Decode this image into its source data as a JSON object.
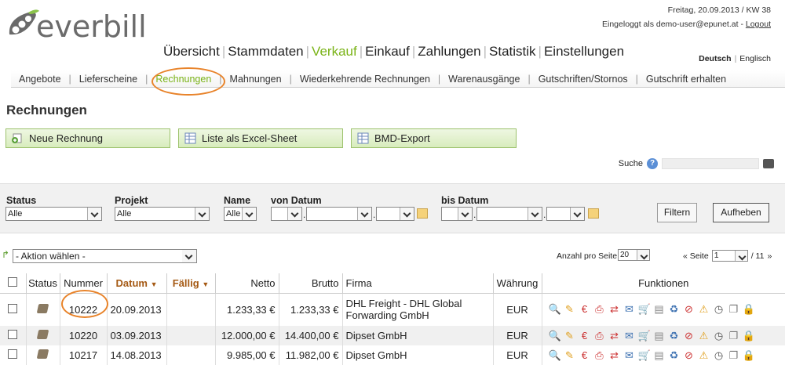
{
  "app": {
    "name": "everbill",
    "date_line": "Freitag, 20.09.2013 / KW 38",
    "login_prefix": "Eingeloggt als demo-user@epunet.at",
    "logout": "Logout",
    "lang_active": "Deutsch",
    "lang_other": "Englisch",
    "accent_color": "#7ab317",
    "highlight_color": "#e8832a"
  },
  "mainnav": [
    "Übersicht",
    "Stammdaten",
    "Verkauf",
    "Einkauf",
    "Zahlungen",
    "Statistik",
    "Einstellungen"
  ],
  "mainnav_active": "Verkauf",
  "subnav": [
    "Angebote",
    "Lieferscheine",
    "Rechnungen",
    "Mahnungen",
    "Wiederkehrende Rechnungen",
    "Warenausgänge",
    "Gutschriften/Stornos",
    "Gutschrift erhalten"
  ],
  "subnav_active": "Rechnungen",
  "page_title": "Rechnungen",
  "buttons": {
    "new": "Neue Rechnung",
    "excel": "Liste als Excel-Sheet",
    "bmd": "BMD-Export"
  },
  "search": {
    "label": "Suche",
    "help": "?"
  },
  "filters": {
    "status": {
      "label": "Status",
      "value": "Alle"
    },
    "projekt": {
      "label": "Projekt",
      "value": "Alle"
    },
    "name": {
      "label": "Name",
      "value": "Alle"
    },
    "von": {
      "label": "von Datum"
    },
    "bis": {
      "label": "bis Datum"
    },
    "filter_btn": "Filtern",
    "reset_btn": "Aufheben"
  },
  "actions": {
    "select": "- Aktion wählen -",
    "per_page_label": "Anzahl pro Seite",
    "per_page": "20",
    "page_prefix": "« Seite",
    "page": "1",
    "page_total": "/ 11",
    "next": "»"
  },
  "table": {
    "headers": {
      "status": "Status",
      "nummer": "Nummer",
      "datum": "Datum",
      "faellig": "Fällig",
      "netto": "Netto",
      "brutto": "Brutto",
      "firma": "Firma",
      "waehrung": "Währung",
      "funktionen": "Funktionen"
    },
    "rows": [
      {
        "nummer": "10222",
        "datum": "20.09.2013",
        "faellig": "",
        "netto": "1.233,33 €",
        "brutto": "1.233,33 €",
        "firma": "DHL Freight - DHL Global Forwarding GmbH",
        "waehrung": "EUR"
      },
      {
        "nummer": "10220",
        "datum": "03.09.2013",
        "faellig": "",
        "netto": "12.000,00 €",
        "brutto": "14.400,00 €",
        "firma": "Dipset GmbH",
        "waehrung": "EUR"
      },
      {
        "nummer": "10217",
        "datum": "14.08.2013",
        "faellig": "",
        "netto": "9.985,00 €",
        "brutto": "11.982,00 €",
        "firma": "Dipset GmbH",
        "waehrung": "EUR"
      }
    ],
    "function_icons": [
      "magnifier-icon",
      "pencil-icon",
      "euro-icon",
      "pdf-icon",
      "pdf-send-icon",
      "mail-icon",
      "cart-icon",
      "document-icon",
      "recycle-icon",
      "document-delete-icon",
      "warning-icon",
      "clock-icon",
      "copy-icon",
      "lock-icon"
    ]
  }
}
